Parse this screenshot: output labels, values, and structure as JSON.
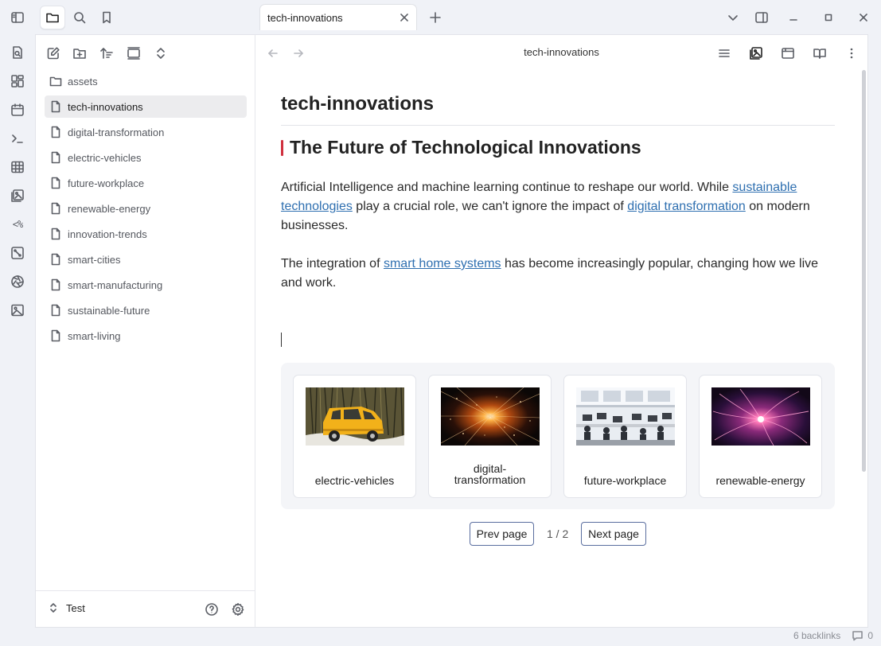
{
  "tab": {
    "title": "tech-innovations"
  },
  "view": {
    "title": "tech-innovations"
  },
  "file_tree": {
    "items": [
      {
        "label": "assets",
        "icon": "folder-icon"
      },
      {
        "label": "tech-innovations",
        "icon": "file-icon",
        "selected": true
      },
      {
        "label": "digital-transformation",
        "icon": "file-icon"
      },
      {
        "label": "electric-vehicles",
        "icon": "file-icon"
      },
      {
        "label": "future-workplace",
        "icon": "file-icon"
      },
      {
        "label": "renewable-energy",
        "icon": "file-icon"
      },
      {
        "label": "innovation-trends",
        "icon": "file-icon"
      },
      {
        "label": "smart-cities",
        "icon": "file-icon"
      },
      {
        "label": "smart-manufacturing",
        "icon": "file-icon"
      },
      {
        "label": "sustainable-future",
        "icon": "file-icon"
      },
      {
        "label": "smart-living",
        "icon": "file-icon"
      }
    ]
  },
  "vault": {
    "name": "Test"
  },
  "note": {
    "title": "tech-innovations",
    "heading": "The Future of Technological Innovations",
    "p1": {
      "t1": "Artificial Intelligence and machine learning continue to reshape our world. While ",
      "link1": "sustainable technologies",
      "t2": " play a crucial role, we can't ignore the impact of ",
      "link2": "digital transformation",
      "t3": " on modern businesses."
    },
    "p2": {
      "t1": "The integration of ",
      "link1": "smart home systems",
      "t2": " has become increasingly popular, changing how we live and work."
    }
  },
  "gallery": {
    "cards": [
      {
        "caption": "electric-vehicles"
      },
      {
        "caption": "digital-\ntransformation"
      },
      {
        "caption": "future-workplace"
      },
      {
        "caption": "renewable-energy"
      }
    ],
    "prev_label": "Prev page",
    "next_label": "Next page",
    "page_indicator": "1 / 2"
  },
  "status": {
    "backlinks": "6 backlinks",
    "comments": "0"
  },
  "colors": {
    "accent_heading_bar": "#d0313f",
    "link": "#2e6fb0"
  }
}
